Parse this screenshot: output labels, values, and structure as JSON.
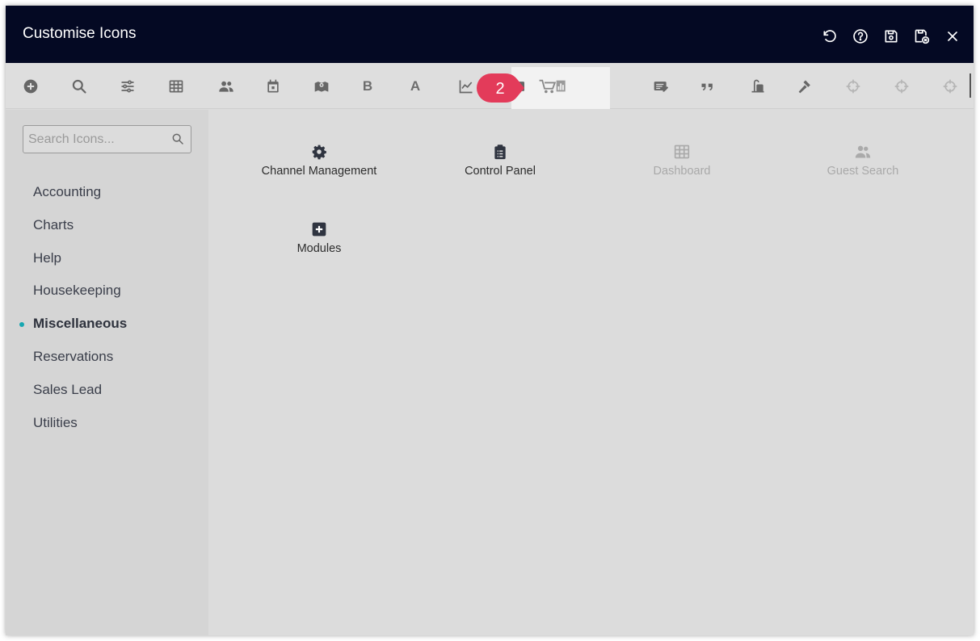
{
  "window": {
    "title": "Customise Icons"
  },
  "title_actions": [
    {
      "name": "undo-icon"
    },
    {
      "name": "help-icon"
    },
    {
      "name": "save-icon"
    },
    {
      "name": "save-close-icon"
    },
    {
      "name": "close-icon"
    }
  ],
  "toolbar": {
    "bold_label": "B",
    "text_label": "A",
    "tools": [
      "add-circle-icon",
      "search-icon",
      "sliders-icon",
      "grid-icon",
      "users-icon",
      "calendar-icon",
      "map-icon",
      "bold-text",
      "text-color",
      "line-chart-icon",
      "cart-chart-icon",
      "note-edit-icon",
      "quote-icon",
      "sign-icon",
      "hammer-icon",
      "crosshair-icon",
      "crosshair-icon",
      "crosshair-icon"
    ]
  },
  "step_badge": "2",
  "sidebar": {
    "search_placeholder": "Search Icons...",
    "categories": [
      {
        "label": "Accounting"
      },
      {
        "label": "Charts"
      },
      {
        "label": "Help"
      },
      {
        "label": "Housekeeping"
      },
      {
        "label": "Miscellaneous",
        "active": true
      },
      {
        "label": "Reservations"
      },
      {
        "label": "Sales Lead"
      },
      {
        "label": "Utilities"
      }
    ]
  },
  "icons": [
    {
      "label": "Channel Management",
      "icon": "gear-icon",
      "enabled": true
    },
    {
      "label": "Control Panel",
      "icon": "clipboard-icon",
      "enabled": true
    },
    {
      "label": "Dashboard",
      "icon": "grid-icon",
      "enabled": false
    },
    {
      "label": "Guest Search",
      "icon": "users-icon",
      "enabled": false
    },
    {
      "label": "Modules",
      "icon": "plus-square-icon",
      "enabled": true
    }
  ],
  "colors": {
    "titlebar": "#040923",
    "active_dot": "#17a7b1",
    "badge": "#e33b5a"
  }
}
